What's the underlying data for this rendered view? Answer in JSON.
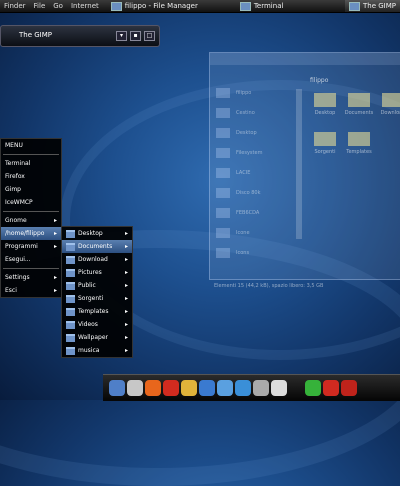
{
  "topbar": {
    "menus": [
      "Finder",
      "File",
      "Go",
      "Internet"
    ],
    "tasks": [
      {
        "label": "filippo - File Manager",
        "active": false
      },
      {
        "label": "Terminal",
        "active": false
      },
      {
        "label": "The GIMP",
        "active": true
      }
    ]
  },
  "gimp_bar": {
    "title": "The GIMP"
  },
  "file_manager": {
    "sidebar": [
      "filippo",
      "Cestino",
      "Desktop",
      "Filesystem",
      "LACIE",
      "Disco 80k",
      "FEB6CDA",
      "Icone",
      "Icons"
    ],
    "items": [
      "Desktop",
      "Documents",
      "Download",
      "Sorgenti",
      "Templates"
    ],
    "status": "Elementi 15 (44,2 kB), spazio libero: 3,5 GB",
    "path": "filippo"
  },
  "main_menu": {
    "items": [
      {
        "label": "MENU",
        "arrow": false,
        "hl": false
      },
      {
        "label": "Terminal",
        "arrow": false,
        "hl": false
      },
      {
        "label": "Firefox",
        "arrow": false,
        "hl": false
      },
      {
        "label": "Gimp",
        "arrow": false,
        "hl": false
      },
      {
        "label": "IceWMCP",
        "arrow": false,
        "hl": false
      },
      {
        "label": "Gnome",
        "arrow": true,
        "hl": false
      },
      {
        "label": "/home/filippo",
        "arrow": true,
        "hl": true
      },
      {
        "label": "Programmi",
        "arrow": true,
        "hl": false
      },
      {
        "label": "Esegui...",
        "arrow": false,
        "hl": false
      },
      {
        "label": "Settings",
        "arrow": true,
        "hl": false
      },
      {
        "label": "Esci",
        "arrow": true,
        "hl": false
      }
    ]
  },
  "submenu": {
    "items": [
      {
        "label": "Desktop",
        "hl": false
      },
      {
        "label": "Documents",
        "hl": true
      },
      {
        "label": "Download",
        "hl": false
      },
      {
        "label": "Pictures",
        "hl": false
      },
      {
        "label": "Public",
        "hl": false
      },
      {
        "label": "Sorgenti",
        "hl": false
      },
      {
        "label": "Templates",
        "hl": false
      },
      {
        "label": "Videos",
        "hl": false
      },
      {
        "label": "Wallpaper",
        "hl": false
      },
      {
        "label": "musica",
        "hl": false
      }
    ]
  },
  "dock": {
    "icons": [
      "folder-icon",
      "terminal-icon",
      "firefox-icon",
      "opera-icon",
      "music-icon",
      "thunderbird-icon",
      "video-icon",
      "media-icon",
      "disk-icon",
      "chat-icon",
      "update-icon",
      "shutdown-icon",
      "power-icon"
    ],
    "colors": [
      "#4f7fc8",
      "#c7c7c7",
      "#e8661c",
      "#d22b1f",
      "#e1b33a",
      "#3a7ad0",
      "#5aa0e0",
      "#3a8fd8",
      "#aaaaaa",
      "#dddddd",
      "#36b23a",
      "#d02a20",
      "#c0231b"
    ]
  }
}
